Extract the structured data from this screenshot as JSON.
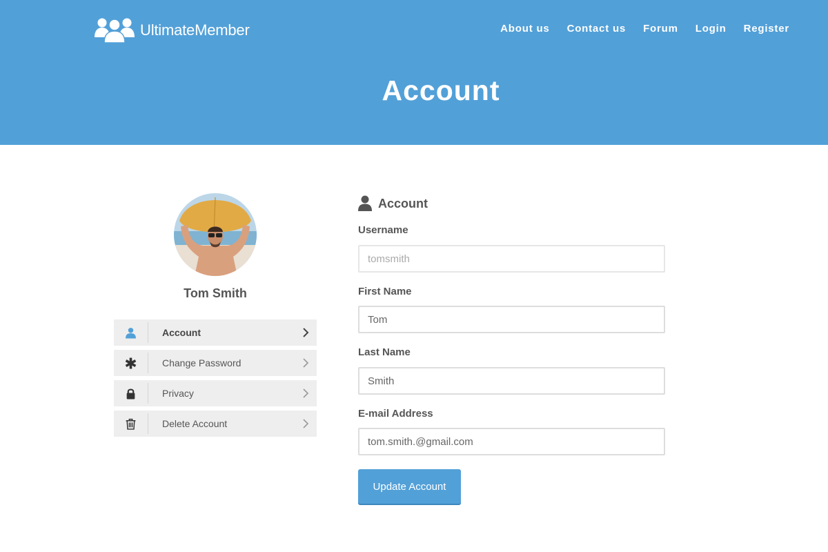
{
  "site": {
    "brand_name": "UltimateMember",
    "logo_icon": "users-group-icon",
    "nav": [
      {
        "label": "About us"
      },
      {
        "label": "Contact us"
      },
      {
        "label": "Forum"
      },
      {
        "label": "Login"
      },
      {
        "label": "Register"
      }
    ],
    "page_title": "Account",
    "colors": {
      "primary": "#52a0d8",
      "text": "#555555",
      "menu_bg": "#eeeeee"
    }
  },
  "profile": {
    "name": "Tom Smith",
    "avatar_description": "man holding surfboard on beach"
  },
  "account_menu": [
    {
      "label": "Account",
      "icon": "user-icon",
      "active": true
    },
    {
      "label": "Change Password",
      "icon": "asterisk-icon",
      "active": false
    },
    {
      "label": "Privacy",
      "icon": "lock-icon",
      "active": false
    },
    {
      "label": "Delete Account",
      "icon": "trash-icon",
      "active": false
    }
  ],
  "form": {
    "heading": "Account",
    "fields": [
      {
        "label": "Username",
        "value": "tomsmith",
        "readonly": true
      },
      {
        "label": "First Name",
        "value": "Tom"
      },
      {
        "label": "Last Name",
        "value": "Smith"
      },
      {
        "label": "E-mail Address",
        "value": "tom.smith.@gmail.com"
      }
    ],
    "submit_label": "Update Account"
  }
}
